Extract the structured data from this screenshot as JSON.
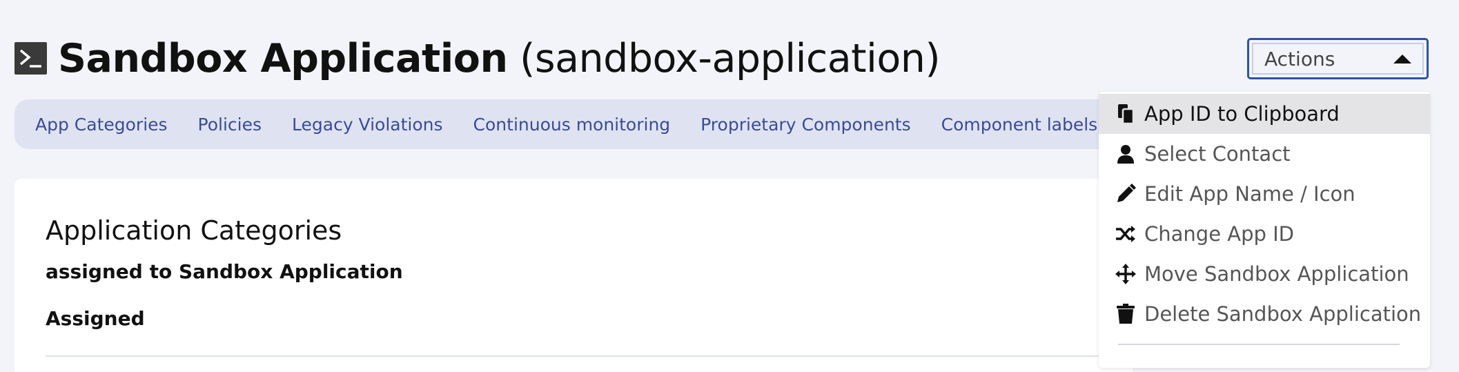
{
  "header": {
    "title_name": "Sandbox Application",
    "title_id": "(sandbox-application)",
    "actions_label": "Actions"
  },
  "tabs": [
    {
      "label": "App Categories"
    },
    {
      "label": "Policies"
    },
    {
      "label": "Legacy Violations"
    },
    {
      "label": "Continuous monitoring"
    },
    {
      "label": "Proprietary Components"
    },
    {
      "label": "Component labels"
    }
  ],
  "card": {
    "title": "Application Categories",
    "subtitle": "assigned to Sandbox Application",
    "assigned_label": "Assigned"
  },
  "menu": {
    "items": [
      {
        "label": "App ID to Clipboard",
        "icon": "clipboard-icon",
        "highlighted": true
      },
      {
        "label": "Select Contact",
        "icon": "user-icon"
      },
      {
        "label": "Edit App Name / Icon",
        "icon": "pencil-icon"
      },
      {
        "label": "Change App ID",
        "icon": "shuffle-icon"
      },
      {
        "label": "Move Sandbox Application",
        "icon": "move-icon"
      },
      {
        "label": "Delete Sandbox Application",
        "icon": "trash-icon"
      }
    ]
  },
  "colors": {
    "background": "#f3f4f9",
    "tab_text": "#3b4a9a",
    "tab_bar": "#dfe3f1",
    "actions_border": "#2c52a8",
    "menu_highlight": "#e4e4e6"
  }
}
